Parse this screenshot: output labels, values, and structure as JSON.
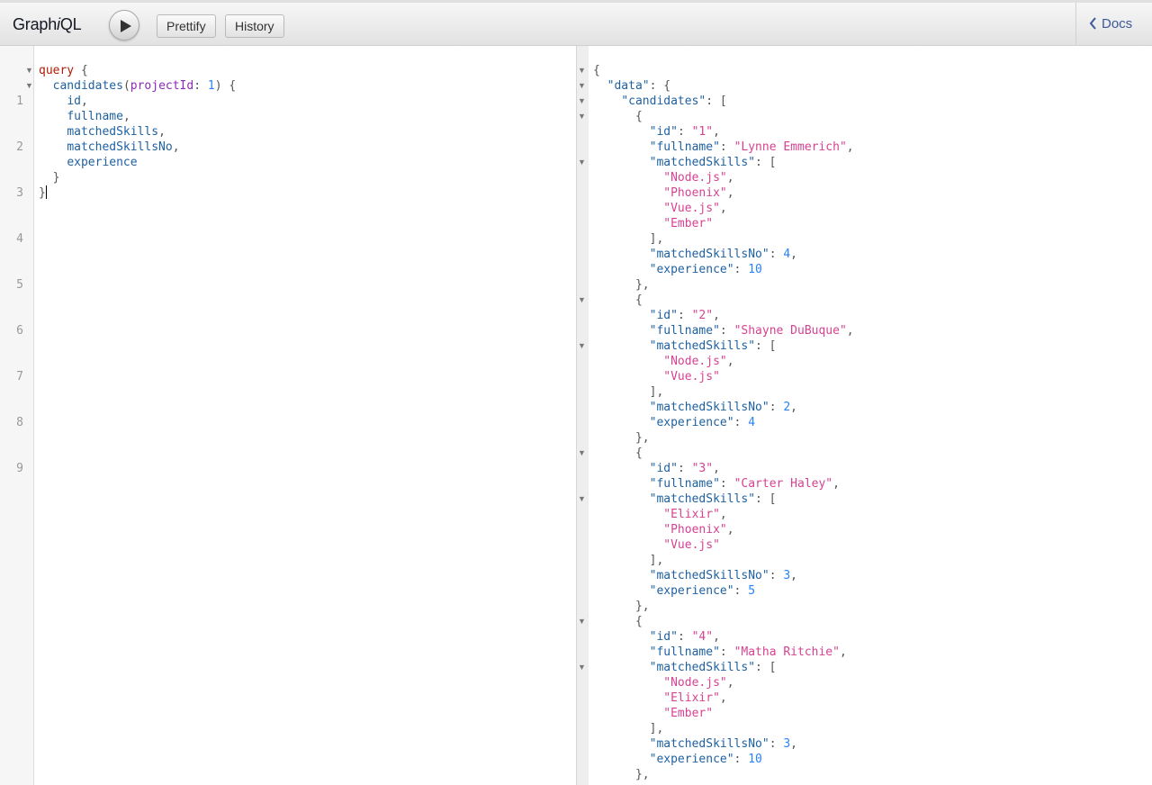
{
  "header": {
    "title_main": "Graph",
    "title_italic": "i",
    "title_end": "QL",
    "run_icon": "play-icon",
    "prettify_label": "Prettify",
    "history_label": "History",
    "docs_label": "Docs",
    "docs_icon": "chevron-left-icon"
  },
  "query_editor": {
    "line_numbers": [
      "1",
      "2",
      "3",
      "4",
      "5",
      "6",
      "7",
      "8",
      "9"
    ],
    "lines": [
      "query {",
      "  candidates(projectId: 1) {",
      "    id,",
      "    fullname,",
      "    matchedSkills,",
      "    matchedSkillsNo,",
      "    experience",
      "  }",
      "}"
    ]
  },
  "result_viewer": {
    "candidates": [
      {
        "id": "1",
        "fullname": "Lynne Emmerich",
        "matchedSkills": [
          "Node.js",
          "Phoenix",
          "Vue.js",
          "Ember"
        ],
        "matchedSkillsNo": "4",
        "experience": "10"
      },
      {
        "id": "2",
        "fullname": "Shayne DuBuque",
        "matchedSkills": [
          "Node.js",
          "Vue.js"
        ],
        "matchedSkillsNo": "2",
        "experience": "4"
      },
      {
        "id": "3",
        "fullname": "Carter Haley",
        "matchedSkills": [
          "Elixir",
          "Phoenix",
          "Vue.js"
        ],
        "matchedSkillsNo": "3",
        "experience": "5"
      },
      {
        "id": "4",
        "fullname": "Matha Ritchie",
        "matchedSkills": [
          "Node.js",
          "Elixir",
          "Ember"
        ],
        "matchedSkillsNo": "3",
        "experience": "10"
      }
    ]
  },
  "colors": {
    "keyword": "#b11a04",
    "field": "#1f61a0",
    "argument": "#8b2bb9",
    "number": "#2882f9",
    "string": "#d64292"
  }
}
